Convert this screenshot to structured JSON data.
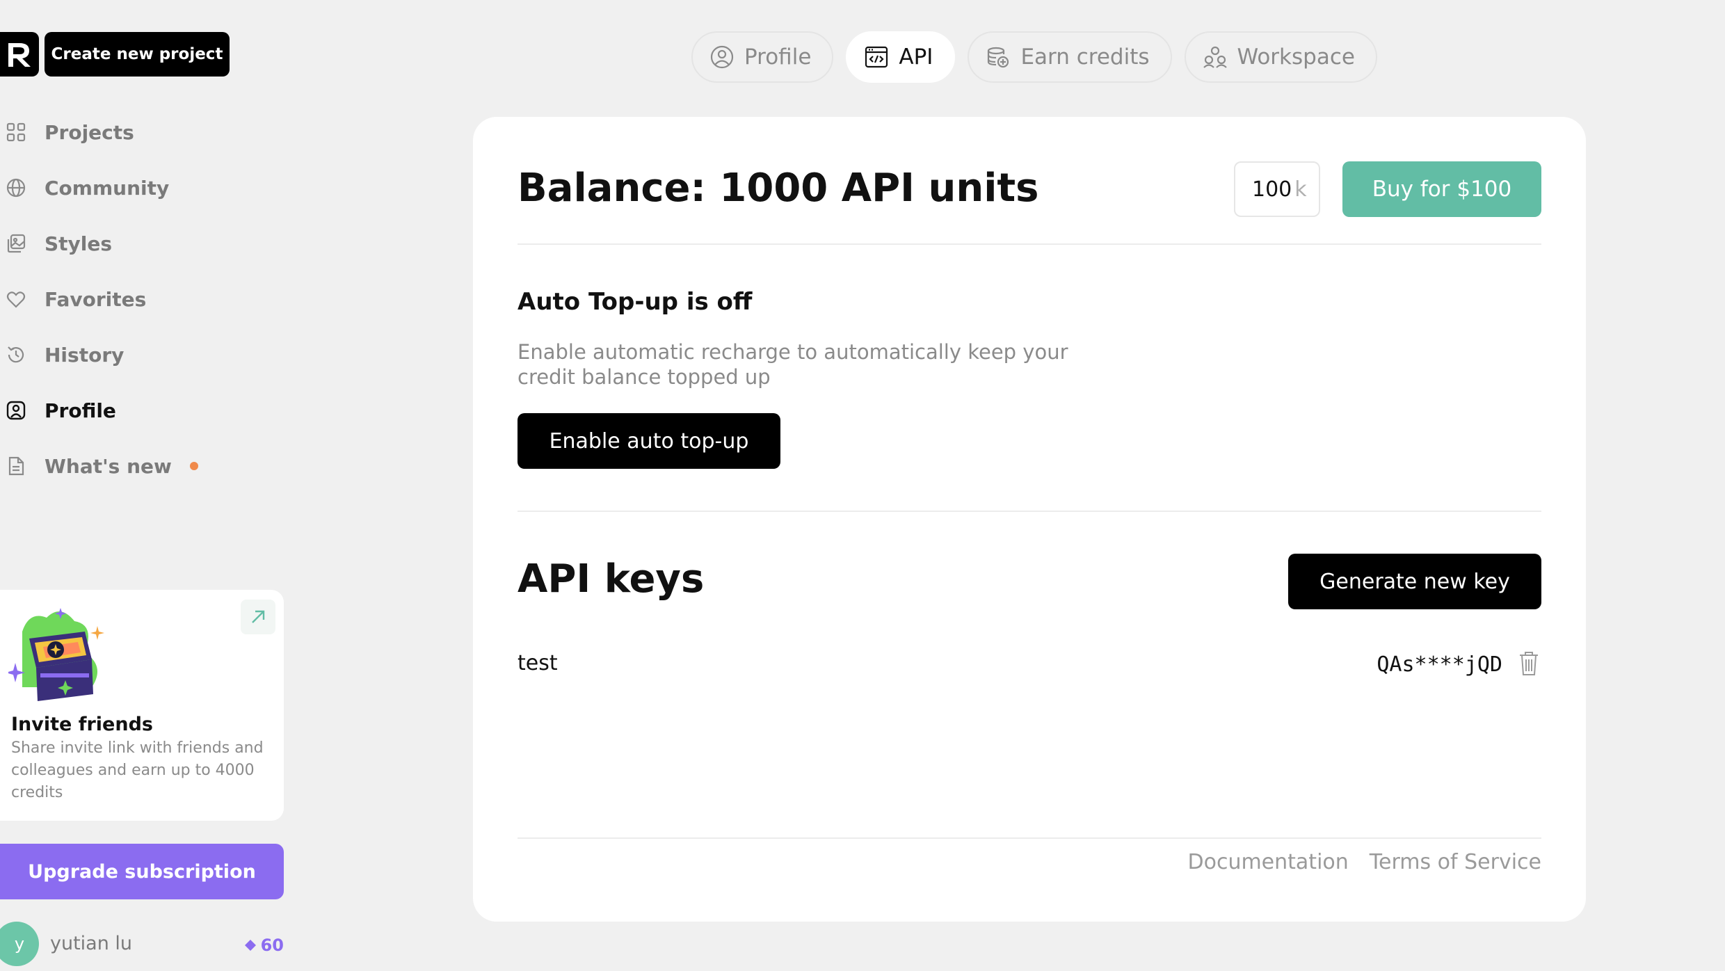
{
  "sidebar": {
    "create_label": "Create new project",
    "items": [
      {
        "label": "Projects",
        "icon": "grid-icon"
      },
      {
        "label": "Community",
        "icon": "globe-icon"
      },
      {
        "label": "Styles",
        "icon": "styles-icon"
      },
      {
        "label": "Favorites",
        "icon": "heart-icon"
      },
      {
        "label": "History",
        "icon": "history-icon"
      },
      {
        "label": "Profile",
        "icon": "profile-icon",
        "active": true
      },
      {
        "label": "What's new",
        "icon": "document-icon",
        "badge_color": "#f08a4b"
      }
    ],
    "invite": {
      "title": "Invite friends",
      "description": "Share invite link with friends and colleagues and earn up to 4000 credits"
    },
    "upgrade_label": "Upgrade subscription",
    "user": {
      "initial": "y",
      "name": "yutian lu",
      "credits": "60"
    }
  },
  "tabs": [
    {
      "label": "Profile",
      "icon": "profile-icon"
    },
    {
      "label": "API",
      "icon": "code-window-icon",
      "active": true
    },
    {
      "label": "Earn credits",
      "icon": "coins-icon"
    },
    {
      "label": "Workspace",
      "icon": "team-icon"
    }
  ],
  "balance": {
    "title": "Balance: 1000 API units",
    "units_value": "100",
    "units_suffix": "k",
    "buy_label": "Buy for $100"
  },
  "auto_topup": {
    "title": "Auto Top-up is off",
    "description": "Enable automatic recharge to automatically keep your credit balance topped up",
    "enable_label": "Enable auto top-up"
  },
  "api_keys": {
    "title": "API keys",
    "generate_label": "Generate new key",
    "keys": [
      {
        "name": "test",
        "masked": "QAs****jQD"
      }
    ]
  },
  "footer": {
    "documentation": "Documentation",
    "terms": "Terms of Service"
  },
  "colors": {
    "accent_green": "#62bda5",
    "accent_purple": "#8b6cf0",
    "dot_orange": "#f08a4b"
  }
}
